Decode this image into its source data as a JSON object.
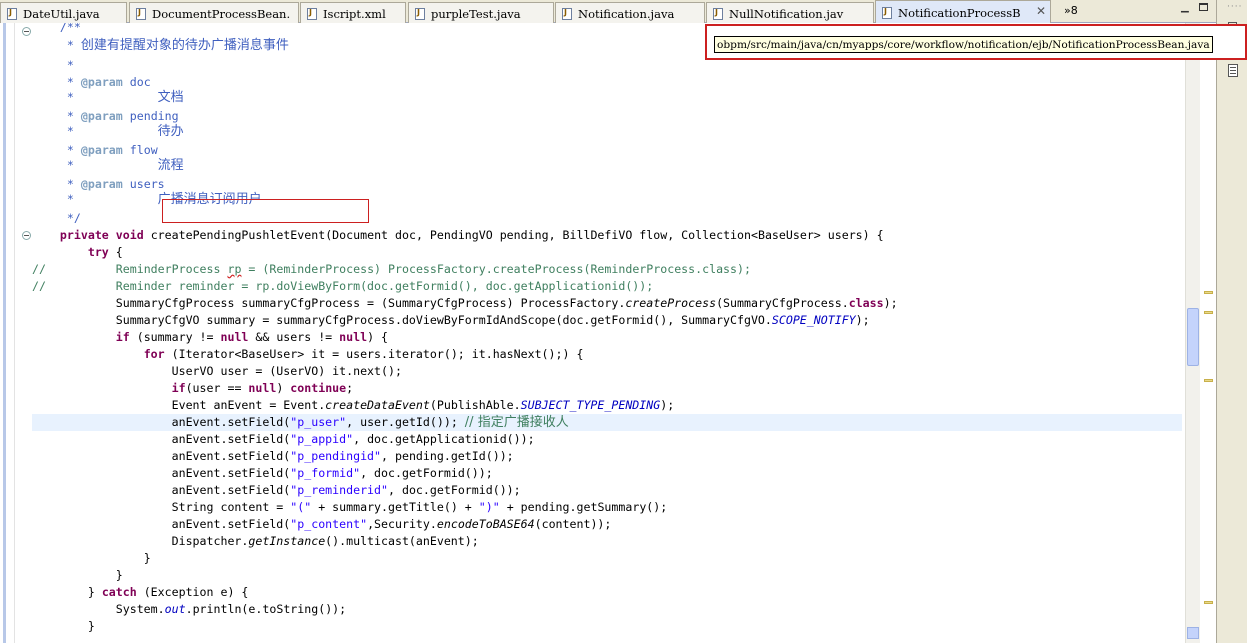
{
  "tabs": [
    {
      "label": "DateUtil.java"
    },
    {
      "label": "DocumentProcessBean."
    },
    {
      "label": "Iscript.xml"
    },
    {
      "label": "purpleTest.java"
    },
    {
      "label": "Notification.java"
    },
    {
      "label": "NullNotification.jav"
    },
    {
      "label": "NotificationProcessB"
    }
  ],
  "tab_overflow": "»8",
  "tooltip": {
    "path": "obpm/src/main/java/cn/myapps/core/workflow/notification/ejb/NotificationProcessBean.java"
  },
  "code": {
    "javadoc_open": "/**",
    "desc": "创建有提醒对象的待办广播消息事件",
    "star": "*",
    "param_tag": "@param",
    "p_doc": "doc",
    "p_doc_desc": "文档",
    "p_pending": "pending",
    "p_pending_desc": "待办",
    "p_flow": "flow",
    "p_flow_desc": "流程",
    "p_users": "users",
    "p_users_desc": "广播消息订阅用户",
    "javadoc_close": "*/",
    "kw_private": "private",
    "kw_void": "void",
    "method_name": "createPendingPushletEvent",
    "method_params": "(Document doc, PendingVO pending, BillDefiVO flow, Collection<BaseUser> users) {",
    "kw_try": "try",
    "brace_open": "{",
    "lc_prefix": "//",
    "l17a": "ReminderProcess ",
    "l17b": "rp",
    "l17c": " = (ReminderProcess) ProcessFactory.createProcess(ReminderProcess.class);",
    "l18": "Reminder reminder = rp.doViewByForm(doc.getFormid(), doc.getApplicationid());",
    "l19a": "SummaryCfgProcess summaryCfgProcess = (SummaryCfgProcess) ProcessFactory.",
    "l19b": "createProcess",
    "l19c": "(SummaryCfgProcess.",
    "l19d": "class",
    "l19e": ");",
    "l20a": "SummaryCfgVO summary = summaryCfgProcess.doViewByFormIdAndScope(doc.getFormid(), SummaryCfgVO.",
    "l20b": "SCOPE_NOTIFY",
    "l20c": ");",
    "kw_if": "if",
    "l21a": " (summary != ",
    "kw_null": "null",
    "l21b": " && users != ",
    "l21c": ") {",
    "kw_for": "for",
    "l22": " (Iterator<BaseUser> it = users.iterator(); it.hasNext();) {",
    "l23": "UserVO user = (UserVO) it.next();",
    "l24a": "(user == ",
    "l24b": ") ",
    "kw_continue": "continue",
    "l24c": ";",
    "l25a": "Event anEvent = Event.",
    "l25b": "createDataEvent",
    "l25c": "(PublishAble.",
    "l25d": "SUBJECT_TYPE_PENDING",
    "l25e": ");",
    "set_field": "anEvent.setField(",
    "s_user": "\"p_user\"",
    "l26b": ", user.getId()); ",
    "l26c": "// 指定广播接收人",
    "s_appid": "\"p_appid\"",
    "l27b": ", doc.getApplicationid());",
    "s_pendingid": "\"p_pendingid\"",
    "l28b": ", pending.getId());",
    "s_formid": "\"p_formid\"",
    "l29b": ", doc.getFormid());",
    "s_reminderid": "\"p_reminderid\"",
    "l30b": ", doc.getFormid());",
    "l31a": "String content = ",
    "s_lparen": "\"(\"",
    "l31b": " + summary.getTitle() + ",
    "s_rparen": "\")\"",
    "l31c": " + pending.getSummary();",
    "s_content": "\"p_content\"",
    "l32b": ",Security.",
    "l32c": "encodeToBASE64",
    "l32d": "(content));",
    "l33a": "Dispatcher.",
    "l33b": "getInstance",
    "l33c": "().multicast(anEvent);",
    "brace_close": "}",
    "catch_close": "} ",
    "kw_catch": "catch",
    "l36b": " (Exception e) {",
    "l37a": "System.",
    "l37b": "out",
    "l37c": ".println(e.toString());"
  }
}
